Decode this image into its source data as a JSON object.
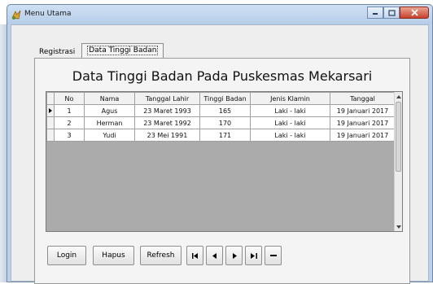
{
  "window": {
    "title": "Menu Utama",
    "controls": [
      "minimize",
      "maximize",
      "close"
    ]
  },
  "tabs": [
    {
      "label": "Registrasi",
      "active": false
    },
    {
      "label": "Data Tinggi Badan",
      "active": true
    }
  ],
  "page": {
    "title": "Data Tinggi Badan Pada Puskesmas Mekarsari"
  },
  "table": {
    "columns": [
      "No",
      "Nama",
      "Tanggal Lahir",
      "Tinggi Badan",
      "Jenis Klamin",
      "Tanggal"
    ],
    "rows": [
      [
        "1",
        "Agus",
        "23 Maret 1993",
        "165",
        "Laki - laki",
        "19 Januari 2017"
      ],
      [
        "2",
        "Herman",
        "23 Maret 1992",
        "170",
        "Laki - laki",
        "19 Januari 2017"
      ],
      [
        "3",
        "Yudi",
        "23 Mei 1991",
        "171",
        "Laki - laki",
        "19 Januari 2017"
      ]
    ],
    "current_row": 1
  },
  "buttons": {
    "login": "Login",
    "hapus": "Hapus",
    "refresh": "Refresh"
  },
  "navigator": [
    "first-record-icon",
    "prev-record-icon",
    "next-record-icon",
    "last-record-icon",
    "delete-record-icon"
  ]
}
